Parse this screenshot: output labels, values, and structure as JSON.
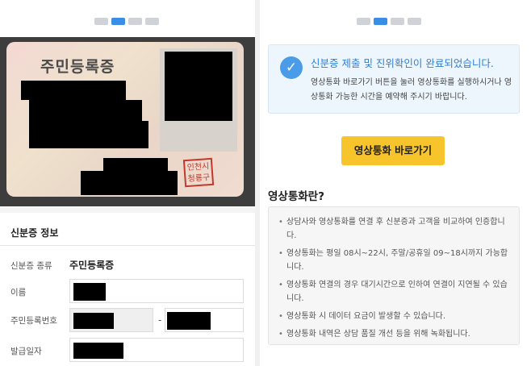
{
  "left": {
    "card_title": "주민등록증",
    "stamp_text": "인천시 청룡구",
    "section_title": "신분증 정보",
    "rows": {
      "type_label": "신분증 종류",
      "type_value": "주민등록증",
      "name_label": "이름",
      "rrn_label": "주민등록번호",
      "rrn_separator": "-",
      "issue_label": "발급일자"
    }
  },
  "right": {
    "notice_title": "신분증 제출 및 진위확인이 완료되었습니다.",
    "notice_body": "영상통화 바로가기 버튼을 눌러 영상통화를 실행하시거나 영상통화 가능한 시간을 예약해 주시기 바랍니다.",
    "video_button": "영상통화 바로가기",
    "what_title": "영상통화란?",
    "items": [
      "상담사와 영상통화를 연결 후 신분증과 고객을 비교하여 인증합니다.",
      "영상통화는 평일 08시~22시, 주말/공휴일 09~18시까지 가능합니다.",
      "영상통화 연결의 경우 대기시간으로 인하여 연결이 지연될 수 있습니다.",
      "영상통화 시 데이터 요금이 발생할 수 있습니다.",
      "영상통화 내역은 상담 품질 개선 등을 위해 녹화됩니다."
    ]
  },
  "icons": {
    "check": "check-circle-icon"
  },
  "colors": {
    "accent": "#3a8ee6",
    "button": "#f7c52b",
    "notice_bg": "#eef6fd"
  }
}
